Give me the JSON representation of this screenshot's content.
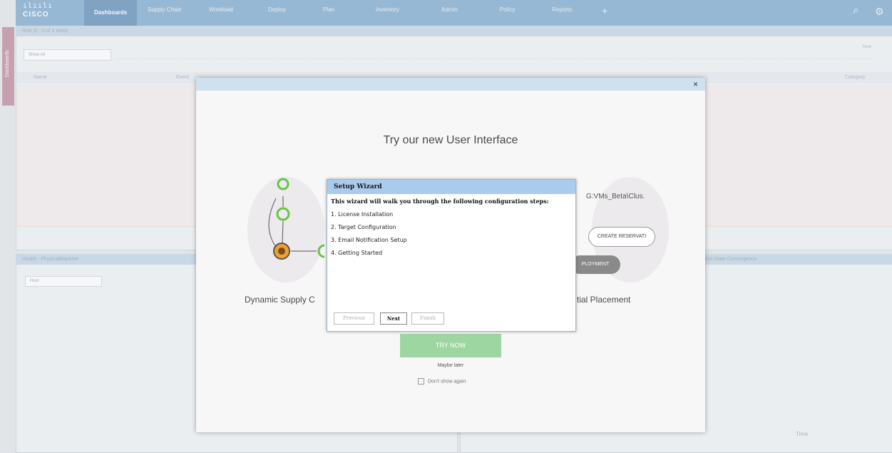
{
  "navbar": {
    "logo_bars": "ılıılı",
    "logo_word": "CISCO",
    "tabs": [
      {
        "label": "Dashboards"
      },
      {
        "label": "Supply Chain"
      },
      {
        "label": "Workload"
      },
      {
        "label": "Deploy"
      },
      {
        "label": "Plan"
      },
      {
        "label": "Inventory"
      },
      {
        "label": "Admin"
      },
      {
        "label": "Policy"
      },
      {
        "label": "Reports"
      }
    ],
    "add_symbol": "+",
    "search_symbol": "⌕",
    "settings_symbol": "⚙"
  },
  "side_tab": {
    "label": "Dashboards"
  },
  "top_panel": {
    "header": "Risk (0 - 0 of 0 rows)",
    "filter_value": "Show All",
    "timeline_labels": [
      "Now"
    ],
    "columns": [
      "Name",
      "Event",
      "Category"
    ]
  },
  "bottom_left_panel": {
    "header": "Health - PhysicalMachine",
    "filter_value": "Host"
  },
  "bottom_right_panel": {
    "header": "Risk State Convergence",
    "time_label": "Time"
  },
  "modal": {
    "close_symbol": "×",
    "title": "Try our new User Interface",
    "feature_left": "Dynamic Supply C",
    "feature_right": "tial Placement",
    "right_card_title": "G:VMs_Beta\\Clus.",
    "right_card_button": "CREATE RESERVATI",
    "right_card_button2": "PLOYMENT",
    "try_now": "TRY NOW",
    "maybe_later": "Maybe later",
    "dont_show": "Don't show again"
  },
  "wizard": {
    "title": "Setup Wizard",
    "intro": "This wizard will walk you through the following configuration steps:",
    "steps": [
      "1. License Installation",
      "2. Target Configuration",
      "3. Email Notification Setup",
      "4. Getting Started"
    ],
    "buttons": {
      "previous": "Previous",
      "next": "Next",
      "finish": "Finish"
    }
  },
  "colors": {
    "navbar": "#6e9ec8",
    "wizard_header": "#a9cbed",
    "try_now": "#9dd6a0",
    "side_tab": "#b67a8e"
  }
}
